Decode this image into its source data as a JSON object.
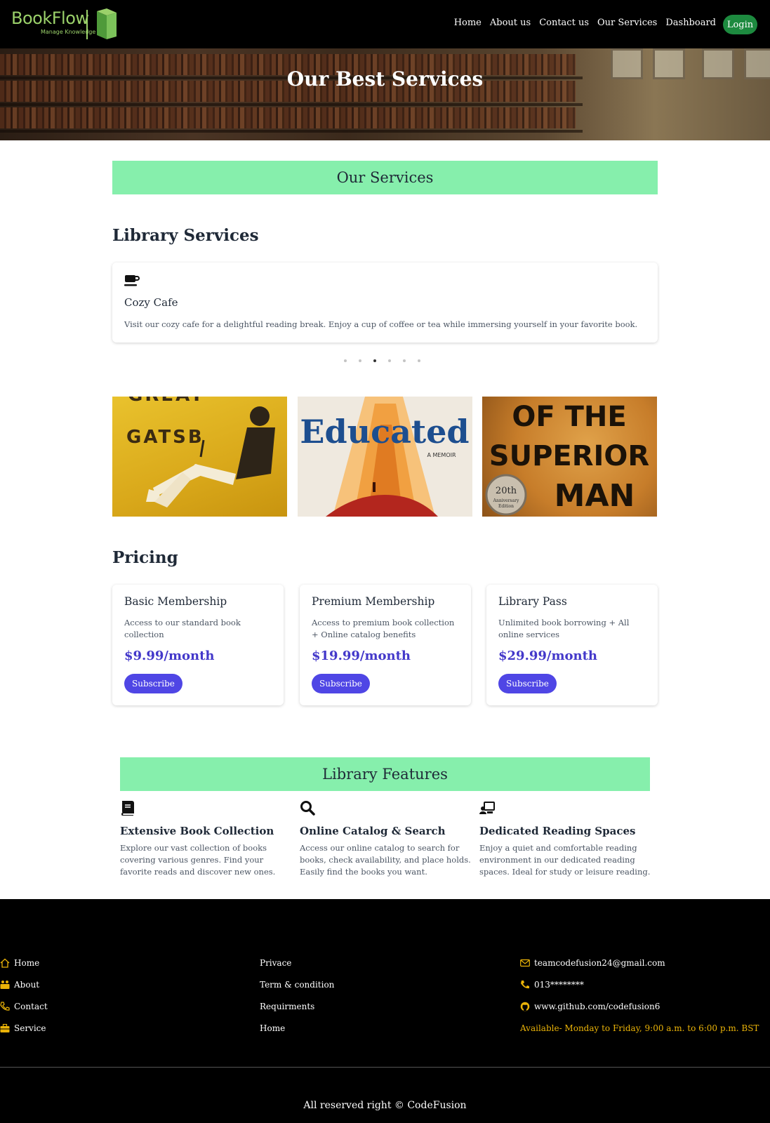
{
  "brand": {
    "name": "BookFlow",
    "tagline": "Manage Knowledge",
    "color": "#9bd16a"
  },
  "nav": {
    "links": [
      "Home",
      "About us",
      "Contact us",
      "Our Services",
      "Dashboard"
    ],
    "login_label": "Login",
    "login_color": "#1d8a3f"
  },
  "hero": {
    "title": "Our Best Services"
  },
  "services_banner": "Our Services",
  "library_services": {
    "heading": "Library Services",
    "active_card": {
      "icon": "coffee-cup-icon",
      "name": "Cozy Cafe",
      "description": "Visit our cozy cafe for a delightful reading break. Enjoy a cup of coffee or tea while immersing yourself in your favorite book."
    },
    "carousel": {
      "total_slides": 6,
      "active_index": 3
    }
  },
  "book_covers": [
    {
      "title_words": [
        "GREAT",
        "GATSB"
      ]
    },
    {
      "title_words": [
        "Educated",
        "A MEMOIR"
      ]
    },
    {
      "title_words": [
        "OF THE",
        "SUPERIOR",
        "MAN"
      ],
      "badge": [
        "20th",
        "Anniversary",
        "Edition"
      ]
    }
  ],
  "pricing": {
    "heading": "Pricing",
    "plans": [
      {
        "name": "Basic Membership",
        "description": "Access to our standard book collection",
        "price": "$9.99/month",
        "button": "Subscribe"
      },
      {
        "name": "Premium Membership",
        "description": "Access to premium book collection + Online catalog benefits",
        "price": "$19.99/month",
        "button": "Subscribe"
      },
      {
        "name": "Library Pass",
        "description": "Unlimited book borrowing + All online services",
        "price": "$29.99/month",
        "button": "Subscribe"
      }
    ],
    "accent_color": "#4f46e5"
  },
  "features": {
    "banner": "Library Features",
    "items": [
      {
        "icon": "book-icon",
        "title": "Extensive Book Collection",
        "description": "Explore our vast collection of books covering various genres. Find your favorite reads and discover new ones."
      },
      {
        "icon": "search-icon",
        "title": "Online Catalog & Search",
        "description": "Access our online catalog to search for books, check availability, and place holds. Easily find the books you want."
      },
      {
        "icon": "reading-space-icon",
        "title": "Dedicated Reading Spaces",
        "description": "Enjoy a quiet and comfortable reading environment in our dedicated reading spaces. Ideal for study or leisure reading."
      }
    ],
    "banner_color": "#86efac"
  },
  "footer": {
    "nav": [
      {
        "icon": "home-icon",
        "label": "Home"
      },
      {
        "icon": "about-icon",
        "label": "About"
      },
      {
        "icon": "phone-icon",
        "label": "Contact"
      },
      {
        "icon": "briefcase-icon",
        "label": "Service"
      }
    ],
    "links": [
      "Privace",
      "Term & condition",
      "Requirments",
      "Home"
    ],
    "contact": {
      "email": "teamcodefusion24@gmail.com",
      "phone": "013********",
      "github": "www.github.com/codefusion6",
      "availability": "Available- Monday to Friday, 9:00 a.m. to 6:00 p.m. BST"
    },
    "copyright": "All reserved right © CodeFusion",
    "accent_color": "#eab308"
  }
}
